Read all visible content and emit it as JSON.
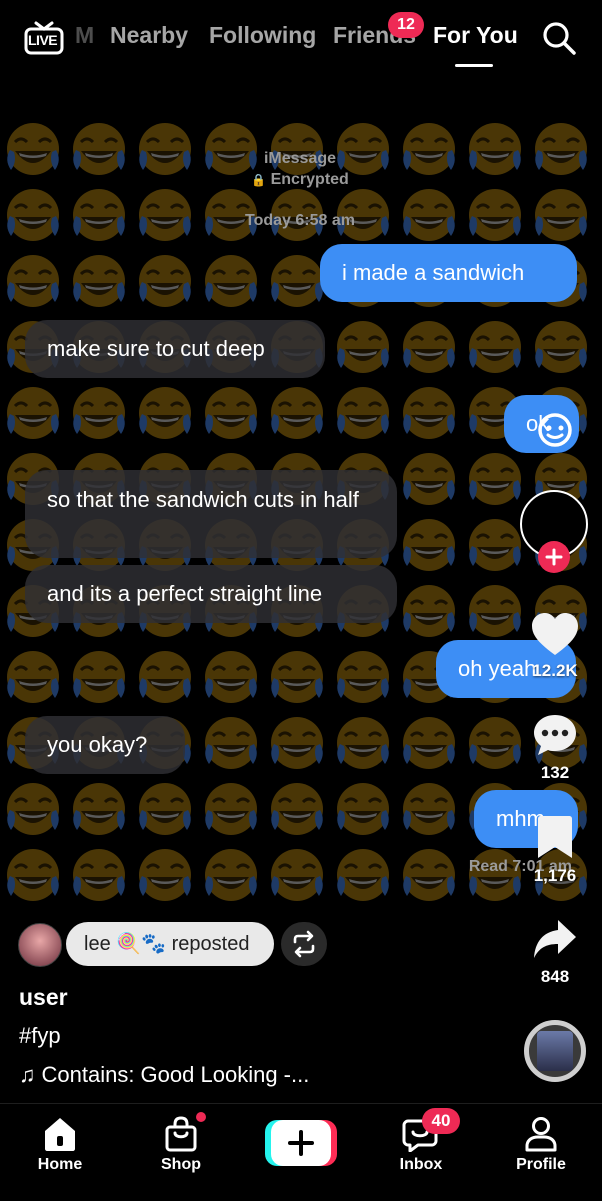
{
  "top_nav": {
    "live_label": "LIVE",
    "partial_tab": "M",
    "tabs": [
      {
        "label": "Nearby"
      },
      {
        "label": "Following"
      },
      {
        "label": "Friends",
        "badge": "12"
      },
      {
        "label": "For You",
        "active": true
      }
    ],
    "search_icon": "search-icon"
  },
  "chat": {
    "service": "iMessage",
    "encryption": "Encrypted",
    "timestamp": "Today 6:58 am",
    "messages": [
      {
        "direction": "out",
        "text": "i made a sandwich"
      },
      {
        "direction": "in",
        "text": "make sure to cut deep"
      },
      {
        "direction": "out",
        "text": "ok"
      },
      {
        "direction": "in",
        "text": "so that the sandwich cuts in half"
      },
      {
        "direction": "in",
        "text": "and its a perfect straight line"
      },
      {
        "direction": "out",
        "text": "oh yeah"
      },
      {
        "direction": "in",
        "text": "you okay?"
      },
      {
        "direction": "out",
        "text": "mhm"
      }
    ],
    "read_receipt": "Read 7:01 am"
  },
  "right_rail": {
    "likes": "12.2K",
    "comments": "132",
    "bookmarks": "1,176",
    "shares": "848"
  },
  "caption": {
    "repost_text": "lee 🍭🐾 reposted",
    "username": "user",
    "hashtag": "#fyp",
    "sound": "Contains: Good Looking -..."
  },
  "bottom_bar": {
    "tabs": [
      {
        "label": "Home"
      },
      {
        "label": "Shop"
      },
      {
        "label": ""
      },
      {
        "label": "Inbox",
        "badge": "40"
      },
      {
        "label": "Profile"
      }
    ]
  },
  "colors": {
    "accent_red": "#ee2a55",
    "imessage_blue": "#3d8ef5",
    "create_cyan": "#25f4ee",
    "create_pink": "#fe2c55"
  }
}
